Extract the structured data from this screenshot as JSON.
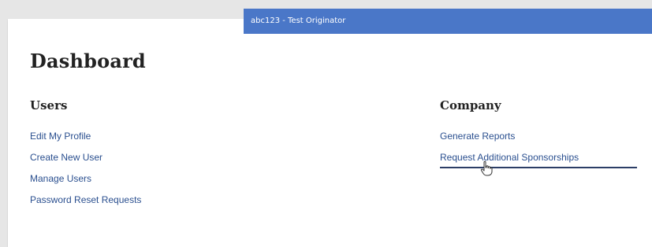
{
  "header": {
    "user_label": "abc123 - Test Originator"
  },
  "dashboard": {
    "title": "Dashboard",
    "users": {
      "heading": "Users",
      "links": [
        "Edit My Profile",
        "Create New User",
        "Manage Users",
        "Password Reset Requests"
      ]
    },
    "company": {
      "heading": "Company",
      "links": [
        "Generate Reports",
        "Request Additional Sponsorships"
      ]
    }
  },
  "colors": {
    "header_bar": "#4a77c8",
    "link": "#2a4f8f",
    "heading": "#222222",
    "background": "#e6e6e6"
  },
  "cursor": {
    "icon": "hand-pointer-icon"
  }
}
